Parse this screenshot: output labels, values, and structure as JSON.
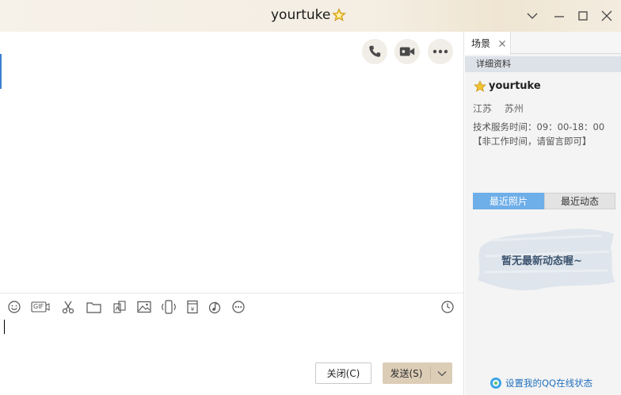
{
  "window": {
    "title": "yourtuke"
  },
  "sidebar": {
    "tab_label": "场景",
    "section_title": "详细资料",
    "profile": {
      "name": "yourtuke",
      "province": "江苏",
      "city": "苏州",
      "description": "技术服务时间：09：00-18：00【非工作时间，请留言即可】"
    },
    "photo_tabs": [
      "最近照片",
      "最近动态"
    ],
    "empty_message": "暂无最新动态喔~",
    "online_status_link": "设置我的QQ在线状态"
  },
  "footer": {
    "close_label": "关闭(C)",
    "send_label": "发送(S)"
  },
  "toolbar": {
    "gif_label": "GIF"
  },
  "colors": {
    "accent_blue": "#6eaee9",
    "send_button": "#dccdb7",
    "star": "#f2c230"
  }
}
